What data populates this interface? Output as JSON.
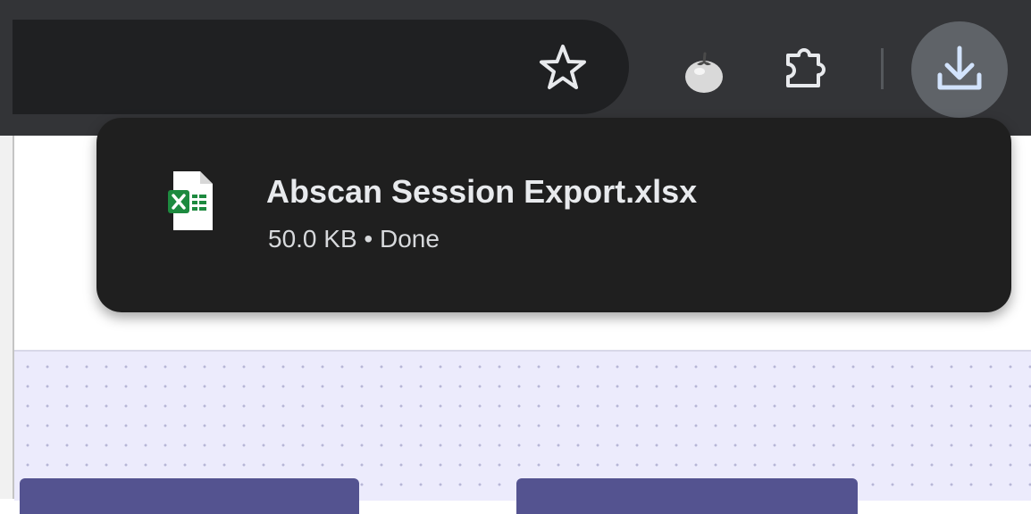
{
  "toolbar": {
    "icons": [
      "star-icon",
      "tomato-extension-icon",
      "puzzle-extensions-icon",
      "download-icon"
    ]
  },
  "downloads_bubble": {
    "file_name": "Abscan Session Export.xlsx",
    "file_status": "50.0 KB • Done",
    "file_icon": "excel-file-icon"
  },
  "colors": {
    "toolbar_bg": "#333437",
    "omnibox_bg": "#1f2022",
    "bubble_bg": "#1f1f1f",
    "download_button_bg": "#5f6368",
    "excel_green": "#1d8a3f",
    "page_dots_bg": "#ecebfc",
    "page_button": "#545390"
  }
}
